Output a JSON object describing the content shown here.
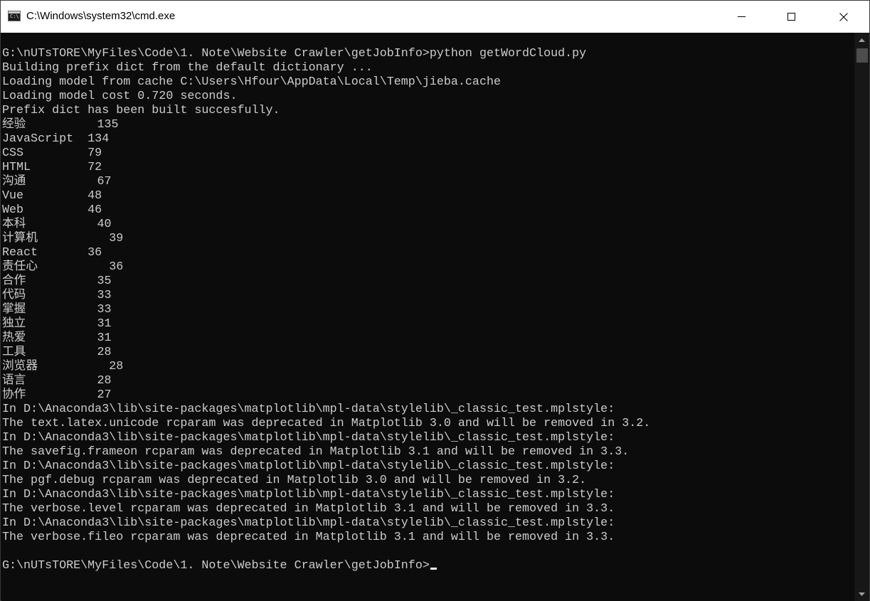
{
  "window": {
    "title": "C:\\Windows\\system32\\cmd.exe",
    "icon": "console-icon",
    "icon_glyph": "C:\\",
    "controls": {
      "minimize": "minimize-icon",
      "maximize": "maximize-icon",
      "close": "close-icon"
    }
  },
  "console": {
    "colors": {
      "background": "#0c0c0c",
      "foreground": "#cccccc"
    },
    "lines": [
      "",
      "G:\\nUTsTORE\\MyFiles\\Code\\1. Note\\Website Crawler\\getJobInfo>python getWordCloud.py",
      "Building prefix dict from the default dictionary ...",
      "Loading model from cache C:\\Users\\Hfour\\AppData\\Local\\Temp\\jieba.cache",
      "Loading model cost 0.720 seconds.",
      "Prefix dict has been built succesfully.",
      "经验          135",
      "JavaScript  134",
      "CSS         79",
      "HTML        72",
      "沟通          67",
      "Vue         48",
      "Web         46",
      "本科          40",
      "计算机          39",
      "React       36",
      "责任心          36",
      "合作          35",
      "代码          33",
      "掌握          33",
      "独立          31",
      "热爱          31",
      "工具          28",
      "浏览器          28",
      "语言          28",
      "协作          27",
      "In D:\\Anaconda3\\lib\\site-packages\\matplotlib\\mpl-data\\stylelib\\_classic_test.mplstyle:",
      "The text.latex.unicode rcparam was deprecated in Matplotlib 3.0 and will be removed in 3.2.",
      "In D:\\Anaconda3\\lib\\site-packages\\matplotlib\\mpl-data\\stylelib\\_classic_test.mplstyle:",
      "The savefig.frameon rcparam was deprecated in Matplotlib 3.1 and will be removed in 3.3.",
      "In D:\\Anaconda3\\lib\\site-packages\\matplotlib\\mpl-data\\stylelib\\_classic_test.mplstyle:",
      "The pgf.debug rcparam was deprecated in Matplotlib 3.0 and will be removed in 3.2.",
      "In D:\\Anaconda3\\lib\\site-packages\\matplotlib\\mpl-data\\stylelib\\_classic_test.mplstyle:",
      "The verbose.level rcparam was deprecated in Matplotlib 3.1 and will be removed in 3.3.",
      "In D:\\Anaconda3\\lib\\site-packages\\matplotlib\\mpl-data\\stylelib\\_classic_test.mplstyle:",
      "The verbose.fileo rcparam was deprecated in Matplotlib 3.1 and will be removed in 3.3.",
      ""
    ],
    "prompt": "G:\\nUTsTORE\\MyFiles\\Code\\1. Note\\Website Crawler\\getJobInfo>"
  },
  "scrollbar": {
    "up_icon": "scroll-up-arrow-icon",
    "down_icon": "scroll-down-arrow-icon"
  }
}
